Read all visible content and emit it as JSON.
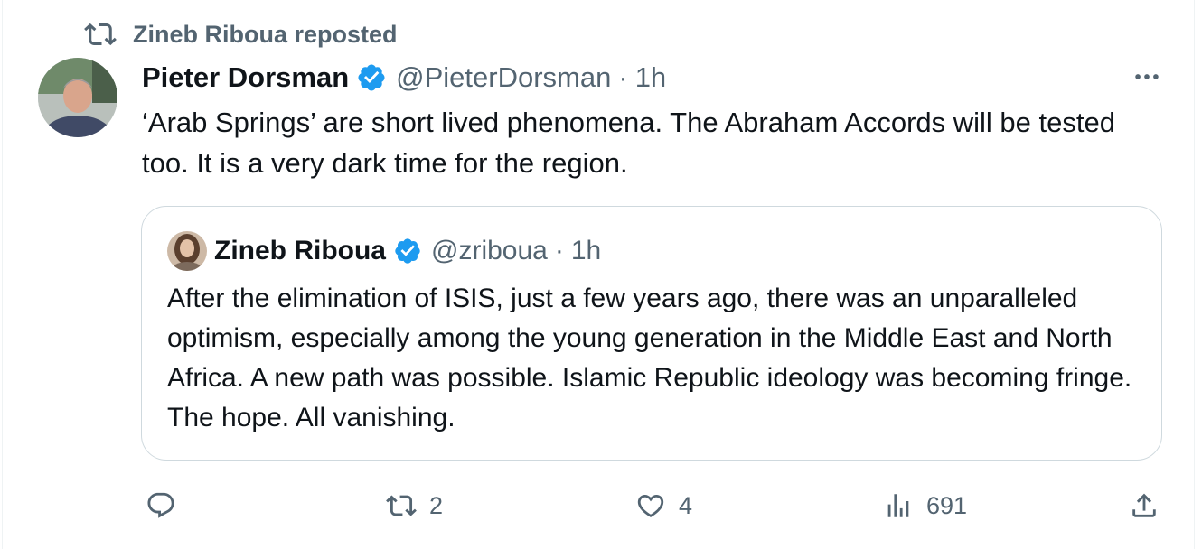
{
  "repost": {
    "icon": "repost-icon",
    "label": "Zineb Riboua reposted"
  },
  "tweet": {
    "author_name": "Pieter Dorsman",
    "author_handle": "@PieterDorsman",
    "separator": "·",
    "time": "1h",
    "text": "‘Arab Springs’ are short lived phenomena. The Abraham Accords will be tested too. It is a very dark time for the region."
  },
  "quote": {
    "author_name": "Zineb Riboua",
    "author_handle": "@zriboua",
    "separator": "·",
    "time": "1h",
    "text": "After the elimination of ISIS, just a few years ago, there was an unparalleled optimism, especially among the young generation in the Middle East and North Africa. A new path was possible. Islamic Republic ideology was becoming fringe. The hope. All vanishing."
  },
  "actions": {
    "reply_count": "",
    "repost_count": "2",
    "like_count": "4",
    "views_count": "691"
  },
  "colors": {
    "accent": "#1d9bf0",
    "muted": "#536471",
    "text": "#0f1419",
    "border": "#cfd9de"
  }
}
